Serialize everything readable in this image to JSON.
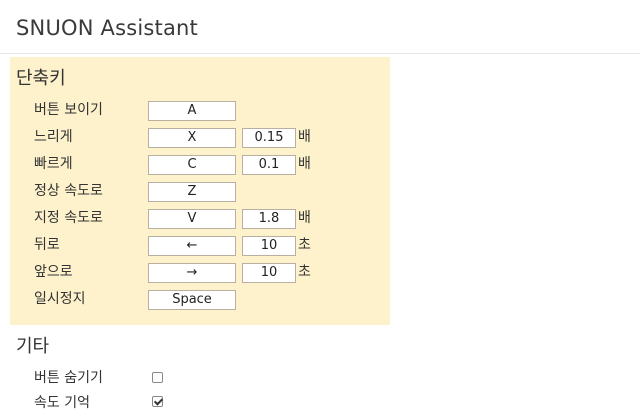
{
  "app": {
    "title": "SNUON Assistant"
  },
  "shortcuts": {
    "title": "단축키",
    "rows": [
      {
        "label": "버튼 보이기",
        "key": "A",
        "value": null,
        "unit": null
      },
      {
        "label": "느리게",
        "key": "X",
        "value": "0.15",
        "unit": "배"
      },
      {
        "label": "빠르게",
        "key": "C",
        "value": "0.1",
        "unit": "배"
      },
      {
        "label": "정상 속도로",
        "key": "Z",
        "value": null,
        "unit": null
      },
      {
        "label": "지정 속도로",
        "key": "V",
        "value": "1.8",
        "unit": "배"
      },
      {
        "label": "뒤로",
        "key": "←",
        "value": "10",
        "unit": "초"
      },
      {
        "label": "앞으로",
        "key": "→",
        "value": "10",
        "unit": "초"
      },
      {
        "label": "일시정지",
        "key": "Space",
        "value": null,
        "unit": null
      }
    ]
  },
  "other": {
    "title": "기타",
    "items": [
      {
        "label": "버튼 숨기기",
        "checked": false
      },
      {
        "label": "속도 기억",
        "checked": true
      }
    ]
  },
  "colors": {
    "panel_bg": "#fdf2cc",
    "input_border": "#b8b0a0"
  }
}
